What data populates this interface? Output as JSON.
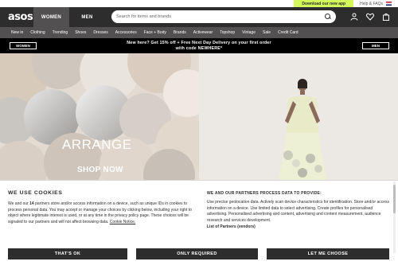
{
  "utility": {
    "app_promo": "Download our new app",
    "help": "Help & FAQs"
  },
  "header": {
    "logo": "asos",
    "tabs": [
      {
        "label": "WOMEN"
      },
      {
        "label": "MEN"
      }
    ],
    "search_placeholder": "Search for items and brands"
  },
  "category_nav": [
    "New in",
    "Clothing",
    "Trending",
    "Shoes",
    "Dresses",
    "Accessories",
    "Face + Body",
    "Brands",
    "Activewear",
    "Topshop",
    "Vintage",
    "Sale",
    "Credit Card"
  ],
  "promo_banner": {
    "line1": "New here? Get 15% off + Free Next Day Delivery on your first order",
    "line2": "with code NEWHERE*",
    "women_button": "WOMEN",
    "men_button": "MEN"
  },
  "hero": {
    "title": "ARRANGE",
    "cta": "SHOP NOW"
  },
  "cookie": {
    "title": "WE USE COOKIES",
    "body_prefix": "We and our ",
    "partners_count": "14",
    "body_suffix": " partners store and/or access information on a device, such as unique IDs in cookies to process personal data. You may accept or manage your choices by clicking below, including your right to object where legitimate interest is used, or at any time in the privacy policy page. These choices will be signaled to our partners and will not affect browsing data. ",
    "cookie_link": "Cookie Notice.",
    "partners_title": "WE AND OUR PARTNERS PROCESS DATA TO PROVIDE:",
    "partners_body": "Use precise geolocation data. Actively scan device characteristics for identification. Store and/or access information on a device. Use limited data to select advertising. Create profiles for personalised advertising. Personalised advertising and content, advertising and content measurement, audience research and services development.",
    "vendors_link": "List of Partners (vendors)",
    "btn_ok": "THAT'S OK",
    "btn_required": "ONLY REQUIRED",
    "btn_choose": "LET ME CHOOSE"
  },
  "colors": {
    "header": "#2d2d2d",
    "nav": "#525050",
    "app_promo": "#d3f95b",
    "promo_banner": "#000000"
  }
}
